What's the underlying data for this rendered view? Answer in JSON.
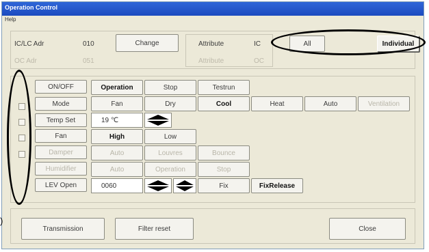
{
  "window": {
    "title": "Operation Control",
    "menu_help": "Help"
  },
  "address": {
    "ic_label": "IC/LC Adr",
    "ic_value": "010",
    "oc_label": "OC Adr",
    "oc_value": "051",
    "change_label": "Change",
    "attr_label": "Attribute",
    "attr_value": "IC",
    "attr2_label": "Attribute",
    "attr2_value": "OC",
    "all_label": "All",
    "individual_label": "Individual"
  },
  "rows": {
    "onoff": {
      "label": "ON/OFF",
      "buttons": [
        "Operation",
        "Stop",
        "Testrun"
      ]
    },
    "mode": {
      "label": "Mode",
      "buttons": [
        "Fan",
        "Dry",
        "Cool",
        "Heat",
        "Auto",
        "Ventilation"
      ]
    },
    "temp": {
      "label": "Temp Set",
      "value": "19 ℃"
    },
    "fan": {
      "label": "Fan",
      "buttons": [
        "High",
        "Low"
      ]
    },
    "damper": {
      "label": "Damper",
      "buttons": [
        "Auto",
        "Louvres",
        "Bounce"
      ]
    },
    "humidifier": {
      "label": "Humidifier",
      "buttons": [
        "Auto",
        "Operation",
        "Stop"
      ]
    },
    "lev": {
      "label": "LEV Open",
      "value": "0060",
      "buttons": [
        "Fix",
        "FixRelease"
      ]
    }
  },
  "footer": {
    "transmission_label": "Transmission",
    "filter_label": "Filter reset",
    "close_label": "Close",
    "left_mark": ")"
  }
}
